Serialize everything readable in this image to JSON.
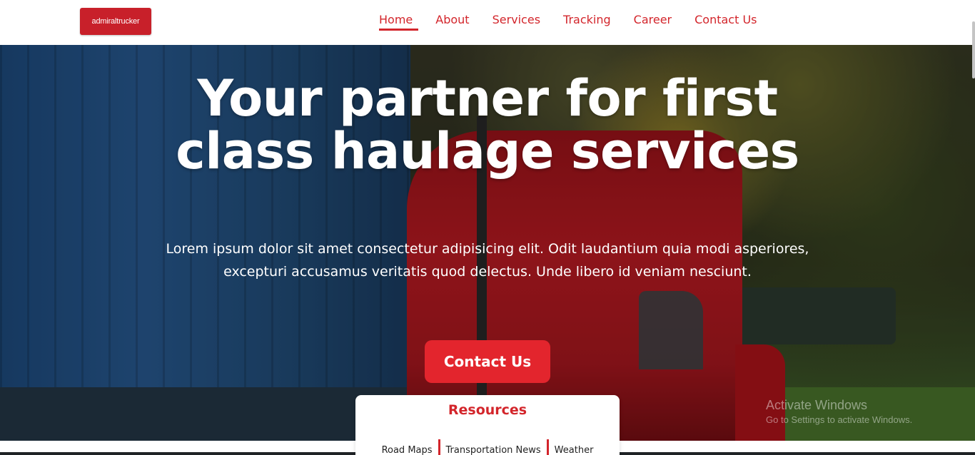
{
  "header": {
    "logo": {
      "text_a": "admiral",
      "text_b": "trucker"
    },
    "nav": [
      {
        "label": "Home",
        "active": true
      },
      {
        "label": "About",
        "active": false
      },
      {
        "label": "Services",
        "active": false
      },
      {
        "label": "Tracking",
        "active": false
      },
      {
        "label": "Career",
        "active": false
      },
      {
        "label": "Contact Us",
        "active": false
      }
    ]
  },
  "hero": {
    "title_line1": "Your partner for first",
    "title_line2": "class haulage services",
    "text": "Lorem ipsum dolor sit amet consectetur adipisicing elit. Odit laudantium quia modi asperiores, excepturi accusamus veritatis quod delectus. Unde libero id veniam nesciunt.",
    "cta_label": "Contact Us"
  },
  "resources": {
    "title": "Resources",
    "links": [
      "Road Maps",
      "Transportation News",
      "Weather"
    ]
  },
  "watermark": {
    "line1": "Activate Windows",
    "line2": "Go to Settings to activate Windows."
  },
  "colors": {
    "brand_red": "#d3252b",
    "cta_red": "#e3252d"
  }
}
